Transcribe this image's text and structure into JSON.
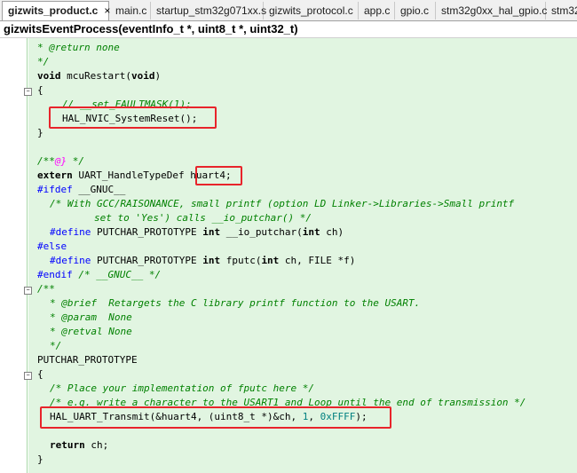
{
  "tabs": [
    {
      "label": "gizwits_product.c",
      "active": true,
      "close": "×"
    },
    {
      "label": "main.c"
    },
    {
      "label": "startup_stm32g071xx.s"
    },
    {
      "label": "gizwits_protocol.c"
    },
    {
      "label": "app.c"
    },
    {
      "label": "gpio.c"
    },
    {
      "label": "stm32g0xx_hal_gpio.c"
    },
    {
      "label": "stm32"
    }
  ],
  "function_bar": {
    "label": "gizwitsEventProcess(eventInfo_t *, uint8_t *, uint32_t)"
  },
  "code": {
    "l1": "* @return none",
    "l2": "*/",
    "l3a": "void",
    "l3b": " mcuRestart(",
    "l3c": "void",
    "l3d": ")",
    "l4": "{",
    "l5": "// __set_FAULTMASK(1);",
    "l6": "HAL_NVIC_SystemReset();",
    "l7": "}",
    "l9a": "/**",
    "l9b": "@}",
    "l9c": " */",
    "l10a": "extern",
    "l10b": " UART_HandleTypeDef ",
    "l10c": "huart4;",
    "l11a": "#ifdef",
    "l11b": " __GNUC__",
    "l12": "/* With GCC/RAISONANCE, small printf (option LD Linker->Libraries->Small printf",
    "l13": "set to 'Yes') calls __io_putchar() */",
    "l14a": "#define",
    "l14b": " PUTCHAR_PROTOTYPE ",
    "l14c": "int",
    "l14d": " __io_putchar(",
    "l14e": "int",
    "l14f": " ch)",
    "l15": "#else",
    "l16a": "#define",
    "l16b": " PUTCHAR_PROTOTYPE ",
    "l16c": "int",
    "l16d": " fputc(",
    "l16e": "int",
    "l16f": " ch, FILE *f)",
    "l17a": "#endif",
    "l17b": " /* __GNUC__ */",
    "l18": "/**",
    "l19": "* @brief  Retargets the C library printf function to the USART.",
    "l20": "* @param  None",
    "l21": "* @retval None",
    "l22": "*/",
    "l23": "PUTCHAR_PROTOTYPE",
    "l24": "{",
    "l25": "/* Place your implementation of fputc here */",
    "l26": "/* e.g. write a character to the USART1 and Loop until the end of transmission */",
    "l27a": "HAL_UART_Transmit(&huart4, (uint8_t *)&ch, ",
    "l27b": "1",
    "l27c": ", ",
    "l27d": "0xFFFF",
    "l27e": ");",
    "l29a": "return",
    "l29b": " ch;",
    "l30": "}"
  },
  "colors": {
    "comment": "#008000",
    "preprocessor": "#0000ff",
    "number": "#008080",
    "highlight_box": "#e8242b",
    "code_background": "#e1f5e1"
  }
}
